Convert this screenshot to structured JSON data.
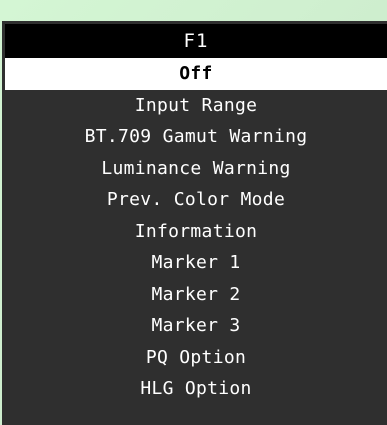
{
  "header": {
    "title": "F1"
  },
  "menu": {
    "items": [
      {
        "label": "Off",
        "selected": true
      },
      {
        "label": "Input Range",
        "selected": false
      },
      {
        "label": "BT.709 Gamut Warning",
        "selected": false
      },
      {
        "label": "Luminance Warning",
        "selected": false
      },
      {
        "label": "Prev. Color Mode",
        "selected": false
      },
      {
        "label": "Information",
        "selected": false
      },
      {
        "label": "Marker 1",
        "selected": false
      },
      {
        "label": "Marker 2",
        "selected": false
      },
      {
        "label": "Marker 3",
        "selected": false
      },
      {
        "label": "PQ Option",
        "selected": false
      },
      {
        "label": "HLG Option",
        "selected": false
      }
    ]
  },
  "colors": {
    "panel": "#2f2f2f",
    "header_bg": "#000000",
    "selected_bg": "#ffffff",
    "text": "#ffffff",
    "surround": "#c8f2c8"
  }
}
